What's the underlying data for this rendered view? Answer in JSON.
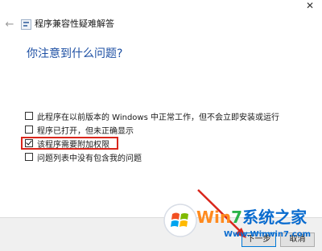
{
  "window": {
    "title": "程序兼容性疑难解答",
    "close_glyph": "✕",
    "back_glyph": "←",
    "back_icon": "back-arrow-icon",
    "app_icon": "troubleshooter-icon"
  },
  "main": {
    "heading": "你注意到什么问题?",
    "options": [
      {
        "label": "此程序在以前版本的 Windows 中正常工作，但不会立即安装或运行",
        "checked": false
      },
      {
        "label": "程序已打开，但未正确显示",
        "checked": false
      },
      {
        "label": "该程序需要附加权限",
        "checked": true
      },
      {
        "label": "问题列表中没有包含我的问题",
        "checked": false
      }
    ]
  },
  "footer": {
    "next_label": "下一步",
    "cancel_label": "取消"
  },
  "annotation": {
    "highlight_color": "#d9261c",
    "arrow_color": "#d9261c"
  },
  "watermark": {
    "brand_prefix": "Win",
    "brand_number": "7",
    "brand_suffix": "系统之家",
    "url": "Www.Winwin7.com"
  }
}
